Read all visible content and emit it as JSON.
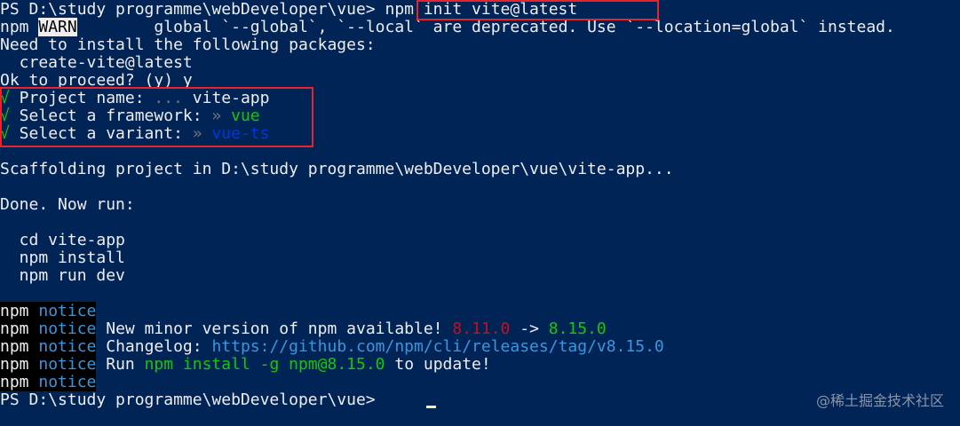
{
  "colors": {
    "background": "#012456",
    "foreground": "#eeedf0",
    "highlight_box": "#e8232a",
    "green": "#16c60c",
    "gray": "#767676",
    "blue": "#0037da",
    "cyan": "#3a96dd",
    "red": "#c50f1f"
  },
  "lines": {
    "l1_prompt": "PS D:\\study programme\\webDeveloper\\vue> ",
    "l1_cmd": "npm init vite@latest",
    "l2_npm": "npm ",
    "l2_warn": "WARN",
    "l2_rest": "        global `--global`, `--local` are deprecated. Use `--location=global` instead.",
    "l3": "Need to install the following packages:",
    "l4": "  create-vite@latest",
    "l5": "Ok to proceed? (y) y",
    "l6_check": "√",
    "l6_label": " Project name: ",
    "l6_dots": "... ",
    "l6_value": "vite-app",
    "l7_check": "√",
    "l7_label": " Select a framework: ",
    "l7_arrow": "» ",
    "l7_value": "vue",
    "l8_check": "√",
    "l8_label": " Select a variant: ",
    "l8_arrow": "» ",
    "l8_value": "vue-ts",
    "l10": "Scaffolding project in D:\\study programme\\webDeveloper\\vue\\vite-app...",
    "l12": "Done. Now run:",
    "l14": "  cd vite-app",
    "l15": "  npm install",
    "l16": "  npm run dev",
    "n1_npm": "npm",
    "n1_notice": "notice",
    "n2_npm": "npm",
    "n2_notice": "notice",
    "n2_text": " New minor version of npm available! ",
    "n2_old": "8.11.0",
    "n2_arrow": " -> ",
    "n2_new": "8.15.0",
    "n3_npm": "npm",
    "n3_notice": "notice",
    "n3_text": " Changelog: ",
    "n3_link": "https://github.com/npm/cli/releases/tag/v8.15.0",
    "n4_npm": "npm",
    "n4_notice": "notice",
    "n4_text": " Run ",
    "n4_cmd": "npm install -g npm@8.15.0",
    "n4_tail": " to update!",
    "n5_npm": "npm",
    "n5_notice": "notice",
    "final_prompt": "PS D:\\study programme\\webDeveloper\\vue> "
  },
  "watermark": "@稀土掘金技术社区"
}
